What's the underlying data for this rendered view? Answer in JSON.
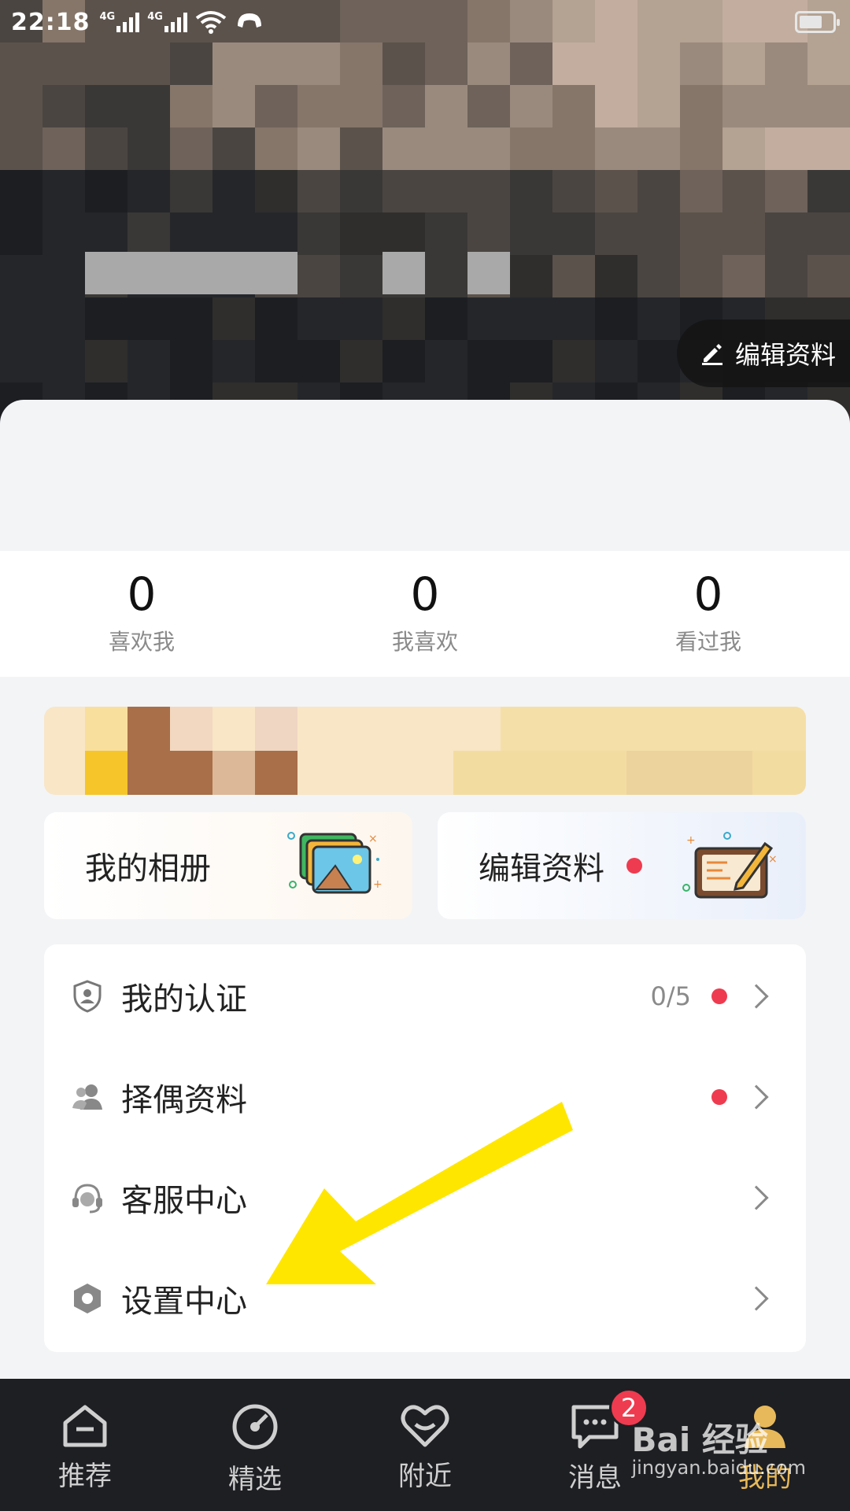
{
  "status_bar": {
    "time": "22:18",
    "network_1": "4G",
    "network_2": "4G"
  },
  "profile": {
    "edit_button_label": "编辑资料"
  },
  "stats": [
    {
      "value": "0",
      "label": "喜欢我"
    },
    {
      "value": "0",
      "label": "我喜欢"
    },
    {
      "value": "0",
      "label": "看过我"
    }
  ],
  "cards": {
    "album_label": "我的相册",
    "edit_label": "编辑资料"
  },
  "menu": {
    "items": [
      {
        "label": "我的认证",
        "count": "0/5",
        "has_dot": true,
        "icon": "shield-user-icon"
      },
      {
        "label": "择偶资料",
        "has_dot": true,
        "icon": "users-icon"
      },
      {
        "label": "客服中心",
        "icon": "headset-icon"
      },
      {
        "label": "设置中心",
        "icon": "hexagon-settings-icon"
      }
    ]
  },
  "bottom_nav": {
    "items": [
      {
        "label": "推荐",
        "icon": "home-icon"
      },
      {
        "label": "精选",
        "icon": "gauge-icon"
      },
      {
        "label": "附近",
        "icon": "heart-icon"
      },
      {
        "label": "消息",
        "icon": "chat-icon",
        "badge": "2"
      },
      {
        "label": "我的",
        "icon": "person-icon",
        "active": true
      }
    ]
  },
  "watermark": {
    "main": "Bai 经验",
    "sub": "jingyan.baidu.com"
  },
  "colors": {
    "accent_red": "#ef3b4f",
    "nav_active": "#e7b95a",
    "arrow_yellow": "#ffe600"
  }
}
